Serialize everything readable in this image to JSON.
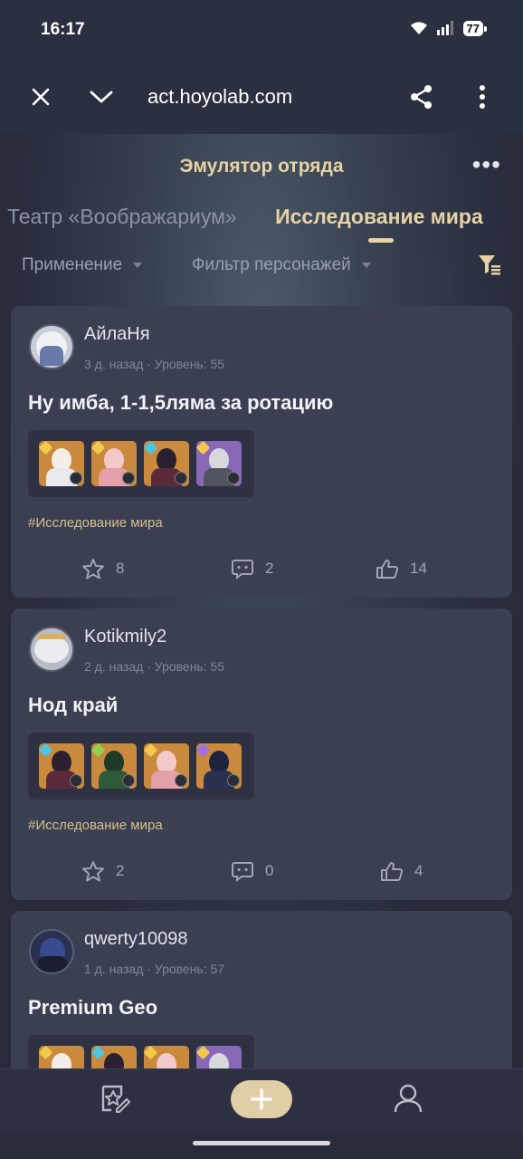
{
  "status_bar": {
    "time": "16:17",
    "battery": "77"
  },
  "browser": {
    "url": "act.hoyolab.com"
  },
  "page": {
    "title": "Эмулятор отряда",
    "tabs": [
      {
        "label": "Театр «Воображариум»",
        "active": false
      },
      {
        "label": "Исследование мира",
        "active": true
      }
    ],
    "filters": {
      "usage": "Применение",
      "character_filter": "Фильтр персонажей"
    }
  },
  "posts": [
    {
      "username": "АйлаНя",
      "meta": "3 д. назад · Уровень: 55",
      "title": "Ну имба, 1-1,5ляма за ротацию",
      "tag": "#Исследование мира",
      "favorites": "8",
      "comments": "2",
      "likes": "14"
    },
    {
      "username": "Kotikmily2",
      "meta": "2 д. назад · Уровень: 55",
      "title": "Нод край",
      "tag": "#Исследование мира",
      "favorites": "2",
      "comments": "0",
      "likes": "4"
    },
    {
      "username": "qwerty10098",
      "meta": "1 д. назад · Уровень: 57",
      "title": "Premium Geo"
    }
  ],
  "colors": {
    "accent": "#e6d3a6",
    "card": "#3a3f52",
    "background": "#262a3a",
    "rarity_5": "#c98a3e",
    "rarity_4": "#8a68b8"
  },
  "icons": {
    "close": "close-icon",
    "collapse": "chevron-down-icon",
    "share": "share-icon",
    "menu": "more-vert-icon",
    "filter": "filter-icon",
    "favorite": "star-icon",
    "comment": "comment-icon",
    "like": "thumb-up-icon"
  }
}
